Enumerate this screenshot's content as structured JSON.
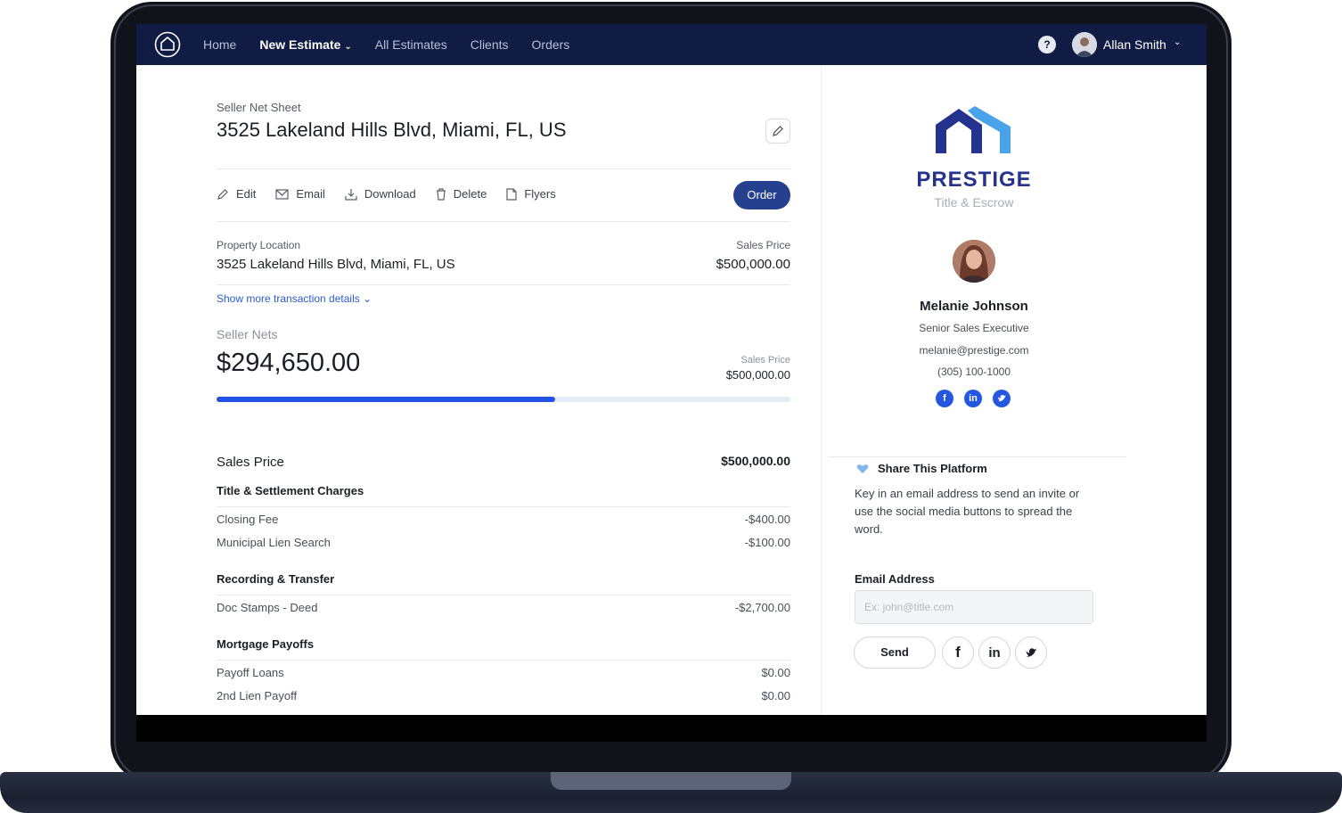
{
  "nav": {
    "links": [
      "Home",
      "New Estimate",
      "All Estimates",
      "Clients",
      "Orders"
    ],
    "active_index": 1,
    "help_label": "?",
    "user_name": "Allan Smith"
  },
  "estimate": {
    "sheet_label": "Seller Net Sheet",
    "address_title": "3525 Lakeland Hills Blvd, Miami, FL, US",
    "actions": {
      "edit": "Edit",
      "email": "Email",
      "download": "Download",
      "delete": "Delete",
      "flyers": "Flyers",
      "order": "Order"
    },
    "property_location_label": "Property Location",
    "property_location_value": "3525 Lakeland Hills Blvd, Miami, FL, US",
    "sales_price_label": "Sales Price",
    "sales_price_value": "$500,000.00",
    "show_more": "Show more transaction details",
    "seller_nets_label": "Seller Nets",
    "seller_nets_value": "$294,650.00",
    "nets_sales_price_label": "Sales Price",
    "nets_sales_price_value": "$500,000.00",
    "nets_ratio": 0.5893
  },
  "breakdown": {
    "sales_price_heading": "Sales Price",
    "sales_price_amount": "$500,000.00",
    "sections": [
      {
        "title": "Title & Settlement Charges",
        "rows": [
          {
            "label": "Closing Fee",
            "amount": "-$400.00"
          },
          {
            "label": "Municipal Lien Search",
            "amount": "-$100.00"
          }
        ]
      },
      {
        "title": "Recording & Transfer",
        "rows": [
          {
            "label": "Doc Stamps - Deed",
            "amount": "-$2,700.00"
          }
        ]
      },
      {
        "title": "Mortgage Payoffs",
        "rows": [
          {
            "label": "Payoff Loans",
            "amount": "$0.00"
          },
          {
            "label": "2nd Lien Payoff",
            "amount": "$0.00"
          }
        ]
      }
    ]
  },
  "company": {
    "name": "PRESTIGE",
    "subtitle": "Title & Escrow",
    "brand_color": "#25338e",
    "accent_color": "#4aa3e8"
  },
  "agent": {
    "name": "Melanie Johnson",
    "title": "Senior Sales Executive",
    "email": "melanie@prestige.com",
    "phone": "(305) 100-1000",
    "social_icons": [
      "facebook-icon",
      "linkedin-icon",
      "twitter-icon"
    ]
  },
  "share": {
    "heading": "Share This Platform",
    "body": "Key in an email address to send an invite or use the social media buttons to spread the word.",
    "email_label": "Email Address",
    "email_placeholder": "Ex: john@title.com",
    "send_label": "Send"
  },
  "colors": {
    "nav_bg": "#111c44",
    "primary_button": "#25408f",
    "progress": "#2450e6",
    "link": "#2d5bd6"
  }
}
